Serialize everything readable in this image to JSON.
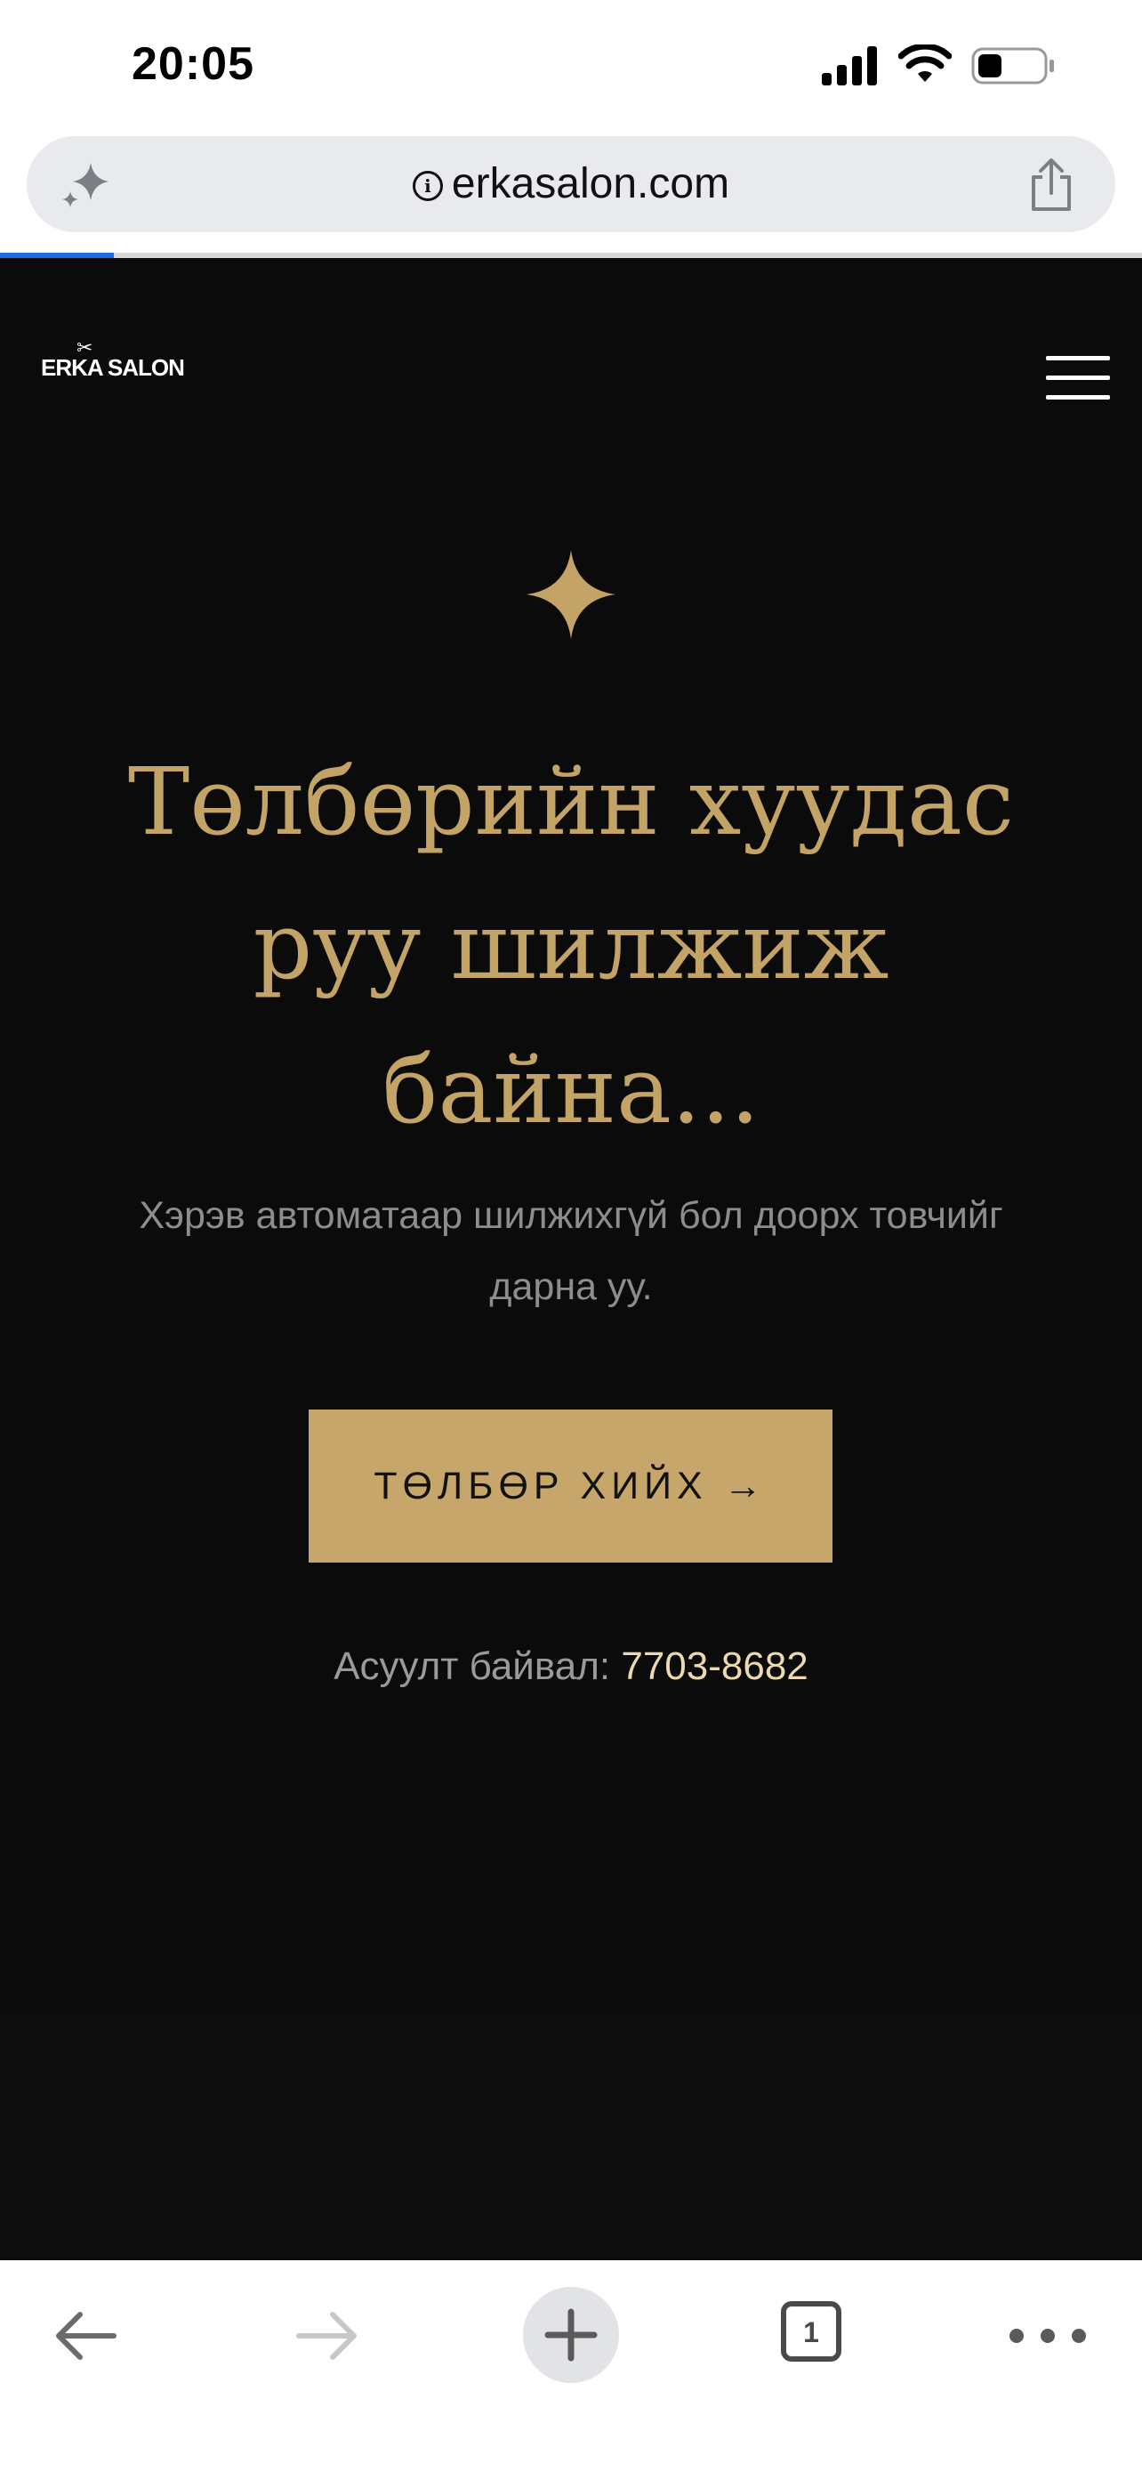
{
  "status_bar": {
    "time": "20:05"
  },
  "browser": {
    "url": "erkasalon.com",
    "tab_count": "1",
    "load_progress": 0.1
  },
  "site": {
    "logo": "ERKA SALON",
    "headline": "Төлбөрийн хуудас руу шилжиж байна...",
    "subtext": "Хэрэв автоматаар шилжихгүй бол доорх товчийг дарна уу.",
    "pay_button": "ТӨЛБӨР ХИЙХ →",
    "contact_prefix": "Асуулт байвал:",
    "contact_phone": "7703-8682"
  },
  "colors": {
    "page_background": "#0b0b0b",
    "accent_gold": "#c4a466",
    "button_gold": "#c6a66a",
    "phone_text": "#ecd9b0"
  },
  "icons": [
    "sparkle-icon",
    "info-icon",
    "share-icon",
    "menu-icon",
    "star-icon",
    "back-arrow-icon",
    "forward-arrow-icon",
    "plus-icon",
    "tabs-icon",
    "more-icon"
  ]
}
